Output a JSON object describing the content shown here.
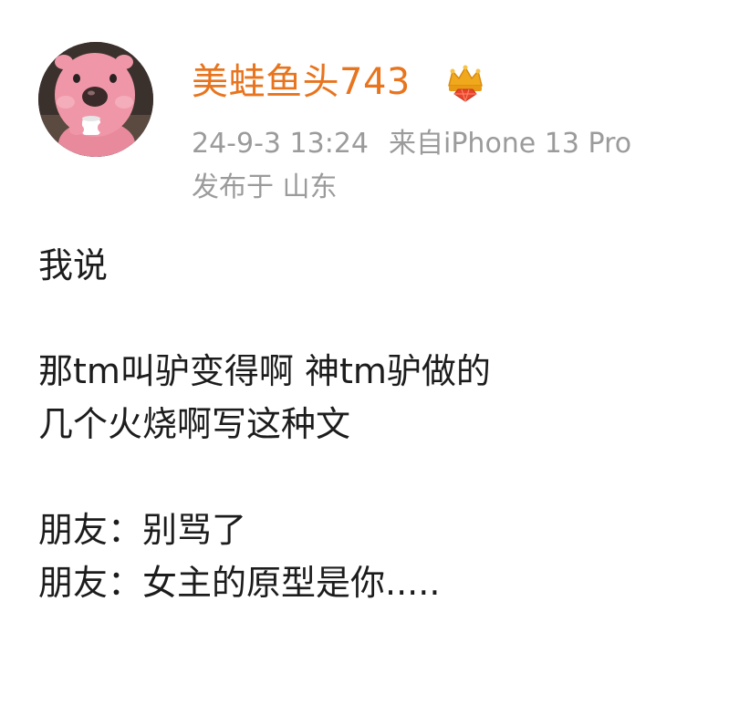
{
  "post": {
    "author": {
      "name": "美蛙鱼头743",
      "avatar": "pink-beaver-avatar",
      "badge_icon": "vip-crown-diamond-icon"
    },
    "meta": {
      "timestamp": "24-9-3 13:24",
      "source": "来自iPhone 13 Pro",
      "location": "发布于 山东"
    },
    "content": {
      "line1": "我说",
      "line2": "那tm叫驴变得啊 神tm驴做的",
      "line3": "几个火烧啊写这种文",
      "line4": "朋友：别骂了",
      "line5": "朋友：女主的原型是你....."
    }
  },
  "colors": {
    "username": "#e8741e",
    "meta": "#9b9b9b",
    "text": "#1c1c1c",
    "badge_gold": "#f0a81c",
    "badge_red": "#e8452c"
  }
}
